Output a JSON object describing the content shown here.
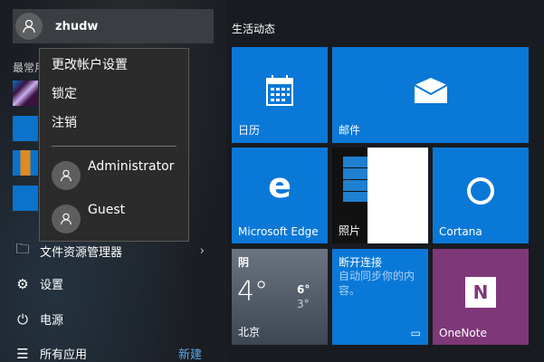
{
  "user": {
    "name": "zhudw"
  },
  "recent_label": "最常用",
  "account_menu": {
    "items": [
      "更改帐户设置",
      "锁定",
      "注销"
    ],
    "accounts": [
      "Administrator",
      "Guest"
    ]
  },
  "nav": {
    "file_explorer": "文件资源管理器",
    "settings": "设置",
    "power": "电源",
    "all_apps": "所有应用",
    "new_label": "新建"
  },
  "tiles": {
    "section_title": "生活动态",
    "calendar": "日历",
    "mail": "邮件",
    "edge": "Microsoft Edge",
    "photos": "照片",
    "cortana": "Cortana",
    "weather": {
      "condition": "阴",
      "temp": "4°",
      "high": "6°",
      "low": "3°",
      "city": "北京"
    },
    "sync": {
      "title": "断开连接",
      "message": "自动同步你的内容。"
    },
    "onenote": "OneNote"
  },
  "colors": {
    "accent": "#0a78d7",
    "onenote": "#7e3878",
    "link": "#5aa6e8"
  }
}
